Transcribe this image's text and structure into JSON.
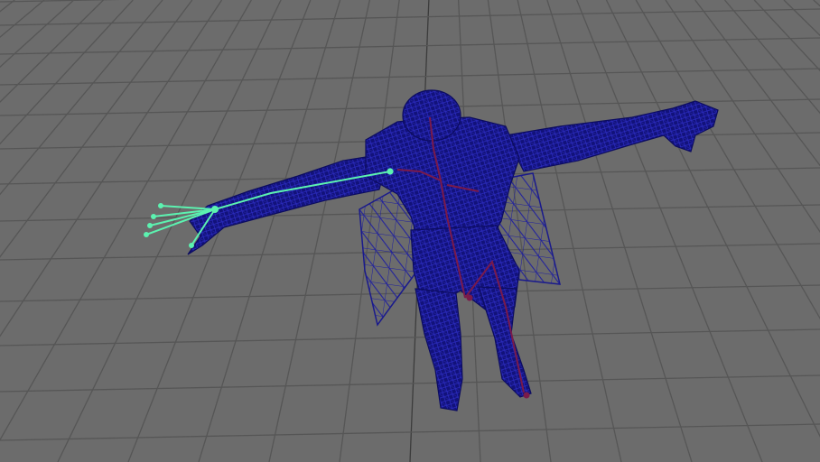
{
  "viewport": {
    "type": "3d-perspective",
    "display_mode": "wireframe",
    "grid_visible": true,
    "selection_highlight": "left-arm-joint-chain"
  },
  "colors": {
    "background": "#6c6c6c",
    "grid_line": "#565656",
    "grid_axis": "#3c3c3c",
    "mesh_wire": "#1a1a8c",
    "mesh_wire_light": "#3b3bd0",
    "skeleton": "#7a1a4a",
    "selected_joint": "#5cf2b0"
  },
  "icons": {
    "mesh": "character-wireframe-icon",
    "skeleton": "joint-chain-icon",
    "cloth": "cape-wireframe-icon"
  }
}
